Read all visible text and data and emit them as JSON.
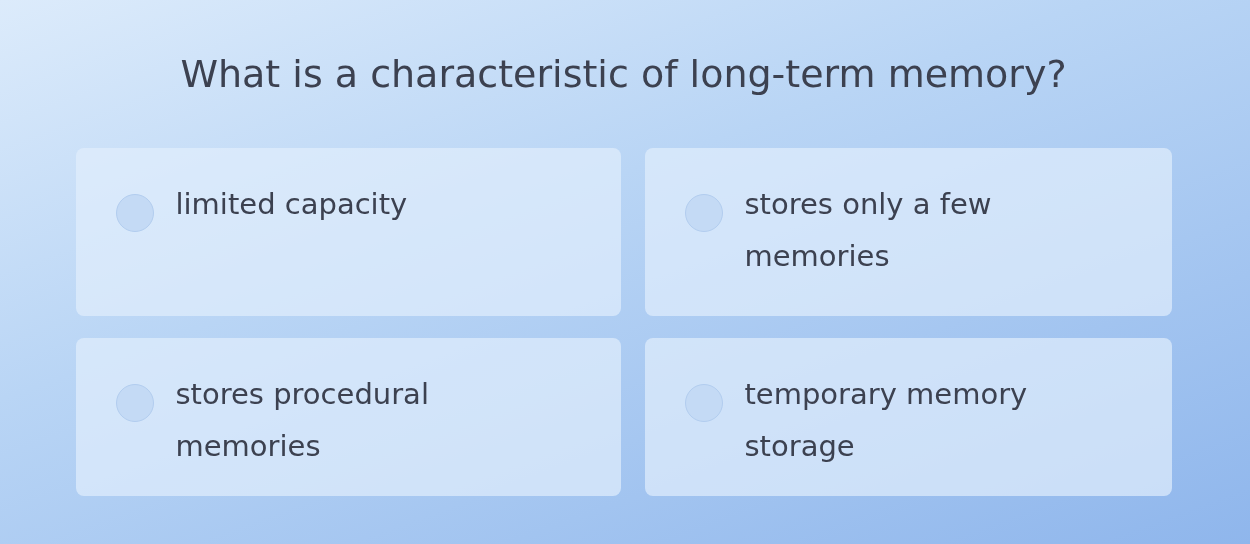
{
  "question": "What is a characteristic of long-term memory?",
  "options": [
    {
      "label": "limited capacity",
      "selected": false
    },
    {
      "label": "stores only a few memories",
      "selected": false
    },
    {
      "label": "stores procedural memories",
      "selected": false
    },
    {
      "label": "temporary memory storage",
      "selected": false
    }
  ]
}
